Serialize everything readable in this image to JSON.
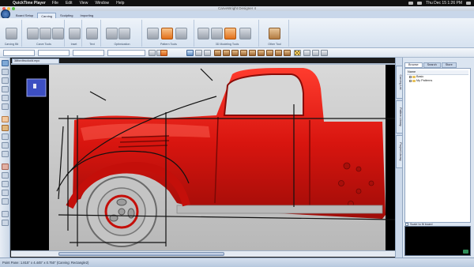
{
  "menubar": {
    "app_name": "QuickTime Player",
    "items": [
      "File",
      "Edit",
      "View",
      "Window",
      "Help"
    ],
    "clock": "Thu Dec 15  1:26 PM"
  },
  "window": {
    "title": "CarveWright Designer 4"
  },
  "ribbon": {
    "tabs": [
      "Board Setup",
      "Carving",
      "Sculpting",
      "Importing"
    ],
    "active_tab": "Carving",
    "groups": [
      {
        "label": "Carving Bit"
      },
      {
        "label": "Carve Tools"
      },
      {
        "label": "Inset"
      },
      {
        "label": "Text"
      },
      {
        "label": "Optimization"
      },
      {
        "label": "Pattern Tools"
      },
      {
        "label": "3D Modeling Tools"
      },
      {
        "label": "Other Tool"
      }
    ]
  },
  "toolbar": {
    "zoom_select": "",
    "style_select": ""
  },
  "document": {
    "tab_label": "38fordtruckold.mpc"
  },
  "right_tabs": [
    "Carving List",
    "Pattern Library",
    "Project Library"
  ],
  "panel": {
    "tabs": [
      "Browse",
      "Search",
      "Store"
    ],
    "active_tab": "Browse",
    "tree_header": "Name",
    "tree_nodes": [
      "Basic",
      "My Patterns"
    ],
    "scale_option": "Scale to fit board"
  },
  "status": {
    "text": "Point Pane: 1.815\" x 4.445\" x 0.750\"  (Carving: Rectangle2)"
  },
  "colors": {
    "truck_red": "#d8150f",
    "canvas_bg": "#000000",
    "board_grey": "#c9c9c9",
    "accent_blue": "#3466ae"
  }
}
